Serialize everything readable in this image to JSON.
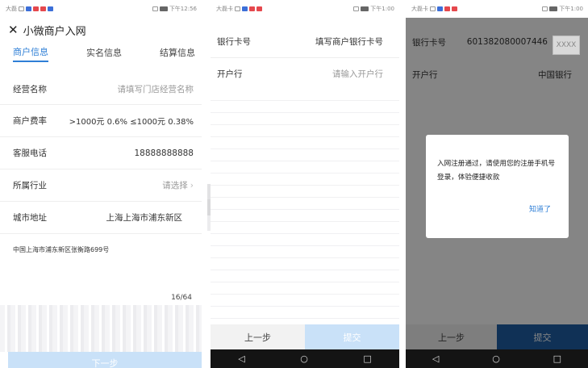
{
  "status": {
    "p1": {
      "carrier": "大磊",
      "time": "下午12:56"
    },
    "p2": {
      "carrier": "大磊卡",
      "time": "下午1:00"
    },
    "p3": {
      "carrier": "大磊卡",
      "time": "下午1:00"
    }
  },
  "screen1": {
    "title": "小微商户入网",
    "tabs": [
      "商户信息",
      "实名信息",
      "结算信息"
    ],
    "rows": [
      {
        "label": "经营名称",
        "value": "请填写门店经营名称"
      },
      {
        "label": "商户费率",
        "value": ">1000元 0.6%  ≤1000元 0.38%"
      },
      {
        "label": "客服电话",
        "value": "18888888888"
      },
      {
        "label": "所属行业",
        "value": "请选择"
      },
      {
        "label": "城市地址",
        "value": "上海上海市浦东新区"
      }
    ],
    "address": "中国上海市浦东新区张衡路699号",
    "counter": "16/64",
    "next_label": "下一步"
  },
  "screen2": {
    "rows": [
      {
        "label": "银行卡号",
        "value": "填写商户银行卡号"
      },
      {
        "label": "开户行",
        "value": "请输入开户行"
      }
    ],
    "prev_label": "上一步",
    "submit_label": "提交"
  },
  "screen3": {
    "rows": [
      {
        "label": "银行卡号",
        "value": "601382080007446"
      },
      {
        "label": "开户行",
        "value": "中国银行"
      }
    ],
    "masked_box": "XXXX",
    "dialog_message": "入网注册通过，请使用您的注册手机号登录，体验便捷收款",
    "dialog_ok": "知道了",
    "prev_label": "上一步",
    "submit_label": "提交"
  },
  "nav": {
    "back": "◁",
    "home": "○",
    "recent": "□"
  },
  "colors": {
    "accent": "#2f7fd6",
    "submit_light": "#c9e1f8",
    "submit_dark": "#1f5fa6"
  }
}
